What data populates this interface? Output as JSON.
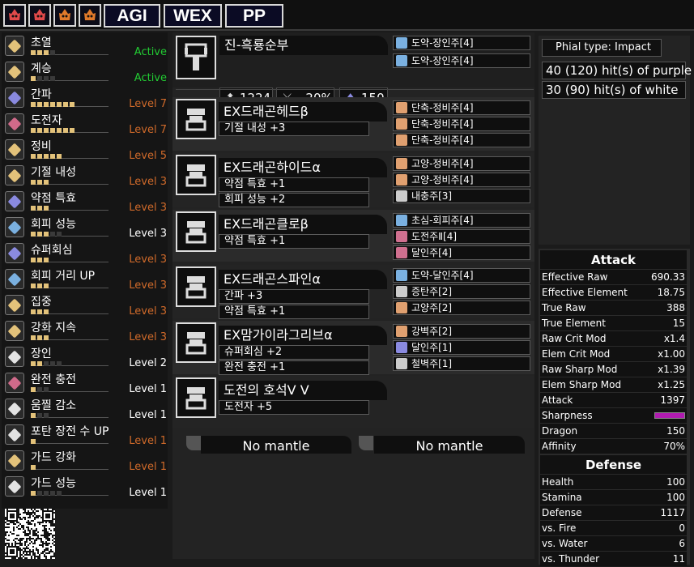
{
  "topbar": {
    "icons": [
      {
        "name": "flame-creature-icon-1",
        "color": "#e04a4a"
      },
      {
        "name": "flame-creature-icon-2",
        "color": "#e04a4a"
      },
      {
        "name": "flame-creature-icon-3",
        "color": "#e07a2a"
      },
      {
        "name": "flame-creature-icon-4",
        "color": "#e07a2a"
      }
    ],
    "tabs": [
      "AGI",
      "WEX",
      "PP"
    ]
  },
  "skills": [
    {
      "name": "초열",
      "level": "Active",
      "color": "#22cc33",
      "pips": [
        1,
        1,
        1,
        0
      ]
    },
    {
      "name": "계승",
      "level": "Active",
      "color": "#22cc33",
      "pips": [
        1,
        0,
        0,
        0
      ]
    },
    {
      "name": "간파",
      "level": "Level 7",
      "color": "#d06a2a",
      "pips": [
        1,
        1,
        1,
        1,
        1,
        1,
        1
      ]
    },
    {
      "name": "도전자",
      "level": "Level 7",
      "color": "#d06a2a",
      "pips": [
        1,
        1,
        1,
        1,
        1,
        1,
        1
      ]
    },
    {
      "name": "정비",
      "level": "Level 5",
      "color": "#d06a2a",
      "pips": [
        1,
        1,
        1,
        1,
        1
      ]
    },
    {
      "name": "기절 내성",
      "level": "Level 3",
      "color": "#d06a2a",
      "pips": [
        1,
        1,
        1
      ]
    },
    {
      "name": "약점 특효",
      "level": "Level 3",
      "color": "#d06a2a",
      "pips": [
        1,
        1,
        1
      ]
    },
    {
      "name": "회피 성능",
      "level": "Level 3",
      "color": "#ffffff",
      "pips": [
        1,
        1,
        1,
        0,
        0
      ]
    },
    {
      "name": "슈퍼회심",
      "level": "Level 3",
      "color": "#d06a2a",
      "pips": [
        1,
        1,
        1
      ]
    },
    {
      "name": "회피 거리 UP",
      "level": "Level 3",
      "color": "#d06a2a",
      "pips": [
        1,
        1,
        1
      ]
    },
    {
      "name": "집중",
      "level": "Level 3",
      "color": "#d06a2a",
      "pips": [
        1,
        1,
        1
      ]
    },
    {
      "name": "강화 지속",
      "level": "Level 3",
      "color": "#d06a2a",
      "pips": [
        1,
        1,
        1
      ]
    },
    {
      "name": "장인",
      "level": "Level 2",
      "color": "#ffffff",
      "pips": [
        1,
        1,
        0,
        0,
        0
      ]
    },
    {
      "name": "완전 충전",
      "level": "Level 1",
      "color": "#ffffff",
      "pips": [
        1,
        0,
        0
      ]
    },
    {
      "name": "움찔 감소",
      "level": "Level 1",
      "color": "#ffffff",
      "pips": [
        1,
        0,
        0
      ]
    },
    {
      "name": "포탄 장전 수 UP",
      "level": "Level 1",
      "color": "#d06a2a",
      "pips": [
        1
      ]
    },
    {
      "name": "가드 강화",
      "level": "Level 1",
      "color": "#d06a2a",
      "pips": [
        1
      ]
    },
    {
      "name": "가드 성능",
      "level": "Level 1",
      "color": "#ffffff",
      "pips": [
        1,
        0,
        0,
        0,
        0
      ]
    }
  ],
  "skill_icon_colors": [
    "#e3c27a",
    "#e3c27a",
    "#8a8ae0",
    "#d06a8a",
    "#e3c27a",
    "#e3c27a",
    "#8a8ae0",
    "#7ab0e0",
    "#8a8ae0",
    "#7ab0e0",
    "#e3c27a",
    "#e3c27a",
    "#e3e3e3",
    "#d06a8a",
    "#e3e3e3",
    "#e3e3e3",
    "#e3c27a",
    "#e3e3e3"
  ],
  "weapon": {
    "name": "진-흑룡순부",
    "attack": "1224",
    "element": "-20%",
    "defense": "150",
    "decos": [
      "도약-장인주[4]",
      "도약-장인주[4]"
    ]
  },
  "armor": [
    {
      "name": "EX드래곤헤드β",
      "skills": [
        "기절 내성 +3"
      ],
      "decos": [
        "단축-정비주[4]",
        "단축-정비주[4]",
        "단축-정비주[4]"
      ],
      "deco_colors": [
        "#e0a070",
        "#e0a070",
        "#e0a070"
      ]
    },
    {
      "name": "EX드래곤하이드α",
      "skills": [
        "약점 특효 +1",
        "회피 성능 +2"
      ],
      "decos": [
        "고양-정비주[4]",
        "고양-정비주[4]",
        "내충주[3]"
      ],
      "deco_colors": [
        "#e0a070",
        "#e0a070",
        "#cccccc"
      ]
    },
    {
      "name": "EX드래곤클로β",
      "skills": [
        "약점 특효 +1"
      ],
      "decos": [
        "초심-회피주[4]",
        "도전주Ⅱ[4]",
        "달인주[4]"
      ],
      "deco_colors": [
        "#7ab0e0",
        "#d07090",
        "#d07090"
      ]
    },
    {
      "name": "EX드래곤스파인α",
      "skills": [
        "간파 +3",
        "약점 특효 +1"
      ],
      "decos": [
        "도약-달인주[4]",
        "증탄주[2]",
        "고양주[2]"
      ],
      "deco_colors": [
        "#7ab0e0",
        "#cccccc",
        "#e0a070"
      ]
    },
    {
      "name": "EX맘가이라그리브α",
      "skills": [
        "슈퍼회심 +2",
        "완전 충전 +1"
      ],
      "decos": [
        "강벽주[2]",
        "달인주[1]",
        "철벽주[1]"
      ],
      "deco_colors": [
        "#e0a070",
        "#8a8ae0",
        "#cccccc"
      ]
    },
    {
      "name": "도전의 호석Ⅴ Ⅴ",
      "skills": [
        "도전자 +5"
      ],
      "decos": [],
      "deco_colors": []
    }
  ],
  "mantles": [
    "No mantle",
    "No mantle"
  ],
  "phial": {
    "type": "Phial type: Impact",
    "purple": "40 (120) hit(s) of purple",
    "white": "30 (90) hit(s) of white"
  },
  "attack_section": {
    "title": "Attack",
    "rows": [
      [
        "Effective Raw",
        "690.33"
      ],
      [
        "Effective Element",
        "18.75"
      ],
      [
        "True Raw",
        "388"
      ],
      [
        "True Element",
        "15"
      ],
      [
        "Raw Crit Mod",
        "x1.4"
      ],
      [
        "Elem Crit Mod",
        "x1.00"
      ],
      [
        "Raw Sharp Mod",
        "x1.39"
      ],
      [
        "Elem Sharp Mod",
        "x1.25"
      ],
      [
        "Attack",
        "1397"
      ],
      [
        "Sharpness",
        ""
      ],
      [
        "Dragon",
        "150"
      ],
      [
        "Affinity",
        "70%"
      ]
    ],
    "sharpness_color": "#b01cb0"
  },
  "defense_section": {
    "title": "Defense",
    "rows": [
      [
        "Health",
        "100"
      ],
      [
        "Stamina",
        "100"
      ],
      [
        "Defense",
        "1117"
      ],
      [
        "vs. Fire",
        "0"
      ],
      [
        "vs. Water",
        "6"
      ],
      [
        "vs. Thunder",
        "11"
      ]
    ]
  }
}
